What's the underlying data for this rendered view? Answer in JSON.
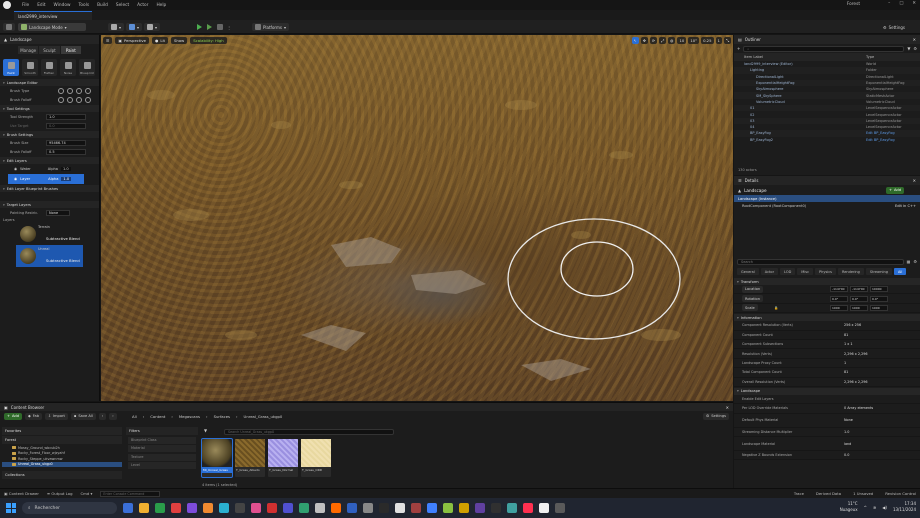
{
  "menu": {
    "items": [
      "File",
      "Edit",
      "Window",
      "Tools",
      "Build",
      "Select",
      "Actor",
      "Help"
    ],
    "project": "Forest"
  },
  "tab": {
    "title": "land2999_interview"
  },
  "toolbar": {
    "mode": "Landscape Mode",
    "platforms": "Platforms",
    "settings": "Settings"
  },
  "left": {
    "title": "Landscape",
    "modes": [
      "Manage",
      "Sculpt",
      "Paint"
    ],
    "tools": [
      "Paint",
      "Smooth",
      "Flatten",
      "Noise",
      "Blueprint"
    ],
    "sections": {
      "editor": "Landscape Editor",
      "tool_settings": "Tool Settings",
      "brush_settings": "Brush Settings",
      "edit_layers": "Edit Layers",
      "blueprint_brushes": "Edit Layer Blueprint Brushes",
      "target_layers": "Target Layers"
    },
    "props": {
      "brush_type": "Brush Type",
      "brush_falloff": "Brush Falloff",
      "tool_strength": "Tool Strength",
      "tool_strength_val": "1.0",
      "use_target": "Use Target",
      "use_target_val": "0.0",
      "brush_size": "Brush Size",
      "brush_size_val": "95466.74",
      "brush_falloff2": "Brush Falloff",
      "brush_falloff2_val": "0.5",
      "painting_restr": "Painting Restric.",
      "painting_restr_val": "None",
      "layers": "Layers"
    },
    "edit_layers": [
      {
        "name": "Water",
        "alpha_label": "Alpha",
        "alpha": "1.0"
      },
      {
        "name": "Layer",
        "alpha_label": "Alpha",
        "alpha": "1.0"
      }
    ],
    "target_layers": [
      {
        "name": "Terrain",
        "blend": "Subtractive Blend"
      },
      {
        "name": "Unreal",
        "blend": "Subtractive Blend"
      }
    ]
  },
  "viewport": {
    "perspective": "Perspective",
    "lit": "Lit",
    "show": "Show",
    "scalability": "Scalability: High",
    "right": [
      "10",
      "10°",
      "0.25",
      "1"
    ]
  },
  "outliner": {
    "title": "Outliner",
    "col_label": "Item Label",
    "col_type": "Type",
    "rows": [
      {
        "name": "land2999_interview (Editor)",
        "type": "World",
        "indent": 10,
        "active": false
      },
      {
        "name": "Lighting",
        "type": "Folder",
        "indent": 16,
        "active": false
      },
      {
        "name": "DirectionalLight",
        "type": "DirectionalLight",
        "indent": 22,
        "active": false
      },
      {
        "name": "ExponentialHeightFog",
        "type": "ExponentialHeightFog",
        "indent": 22,
        "active": false
      },
      {
        "name": "SkyAtmosphere",
        "type": "SkyAtmosphere",
        "indent": 22,
        "active": false
      },
      {
        "name": "SM_SkySphere",
        "type": "StaticMeshActor",
        "indent": 22,
        "active": false
      },
      {
        "name": "VolumetricCloud",
        "type": "VolumetricCloud",
        "indent": 22,
        "active": false
      },
      {
        "name": "01",
        "type": "LevelSequenceActor",
        "indent": 16,
        "active": false
      },
      {
        "name": "02",
        "type": "LevelSequenceActor",
        "indent": 16,
        "active": false
      },
      {
        "name": "03",
        "type": "LevelSequenceActor",
        "indent": 16,
        "active": false
      },
      {
        "name": "04",
        "type": "LevelSequenceActor",
        "indent": 16,
        "active": false
      },
      {
        "name": "BP_EasyFog",
        "type": "Edit BP_EasyFog",
        "indent": 16,
        "active": true
      },
      {
        "name": "BP_EasyFog2",
        "type": "Edit BP_EasyFog",
        "indent": 16,
        "active": true
      }
    ],
    "count": "130 actors"
  },
  "details": {
    "title": "Details",
    "object": "Landscape",
    "add": "Add",
    "instance": "Landscape (Instance)",
    "component": "RootComponent (RootComponent0)",
    "edit_cpp": "Edit in C++",
    "search": "Search",
    "tabs": [
      "General",
      "Actor",
      "LOD",
      "Misc",
      "Physics",
      "Rendering",
      "Streaming",
      "All"
    ],
    "transform": "Transform",
    "location": {
      "label": "Location",
      "vals": [
        "-114700",
        "-114700",
        "10000"
      ]
    },
    "rotation": {
      "label": "Rotation",
      "vals": [
        "0.0°",
        "0.0°",
        "0.0°"
      ]
    },
    "scale": {
      "label": "Scale",
      "vals": [
        "1000",
        "1000",
        "1000"
      ]
    },
    "info_title": "Information",
    "info": [
      {
        "k": "Component Resolution (Verts)",
        "v": "256 x 256"
      },
      {
        "k": "Component Count",
        "v": "81"
      },
      {
        "k": "Component Subsections",
        "v": "1 x 1"
      },
      {
        "k": "Resolution (Verts)",
        "v": "2,296 x 2,296"
      },
      {
        "k": "Landscape Proxy Count",
        "v": "1"
      },
      {
        "k": "Total Component Count",
        "v": "81"
      },
      {
        "k": "Overall Resolution (Verts)",
        "v": "2,296 x 2,296"
      }
    ],
    "landscape_title": "Landscape",
    "landscape": [
      {
        "k": "Enable Edit Layers",
        "v": ""
      },
      {
        "k": "Per LOD Override Materials",
        "v": "0 Array elements"
      },
      {
        "k": "Default Phys Material",
        "v": "None"
      },
      {
        "k": "Streaming Distance Multiplier",
        "v": "1.0"
      },
      {
        "k": "Landscape Material",
        "v": "land"
      },
      {
        "k": "Negative Z Bounds Extension",
        "v": "0.0"
      }
    ]
  },
  "content": {
    "title": "Content Browser",
    "add": "Add",
    "fab": "Fab",
    "import": "Import",
    "save_all": "Save All",
    "settings": "Settings",
    "breadcrumbs": [
      "All",
      "Content",
      "Megascans",
      "Surfaces",
      "Unreal_Grass_ukgp0"
    ],
    "favorites": "Favorites",
    "forest": "Forest",
    "collections": "Collections",
    "folders": [
      "Mossy_Ground_wbcub2h",
      "Rocky_Forest_Floor_wjzyahf",
      "Rocky_Steppe_ukvawnmw",
      "Unreal_Grass_ukgp0"
    ],
    "filters_title": "Filters",
    "filters": [
      "Blueprint Class",
      "Material",
      "Texture",
      "Level"
    ],
    "search": "Search Unreal_Grass_ukgp0",
    "assets": [
      "MI_Unreal_Grass",
      "T_Grass_Albedo",
      "T_Grass_Normal",
      "T_Grass_ORD"
    ],
    "count": "4 items (1 selected)"
  },
  "status": {
    "drawer": "Content Drawer",
    "output": "Output Log",
    "cmd": "Cmd",
    "cmd_placeholder": "Enter Console Command",
    "trace": "Trace",
    "derived": "Derived Data",
    "unsaved": "1 Unsaved",
    "revision": "Revision Control"
  },
  "taskbar": {
    "search": "Rechercher",
    "weather_temp": "11°C",
    "weather_desc": "Nuageux",
    "time": "17:34",
    "date": "13/11/2024"
  },
  "colors": {
    "accent": "#2a6fd6",
    "panel": "#1c1c1c",
    "terrain": "#7a5a2c"
  }
}
